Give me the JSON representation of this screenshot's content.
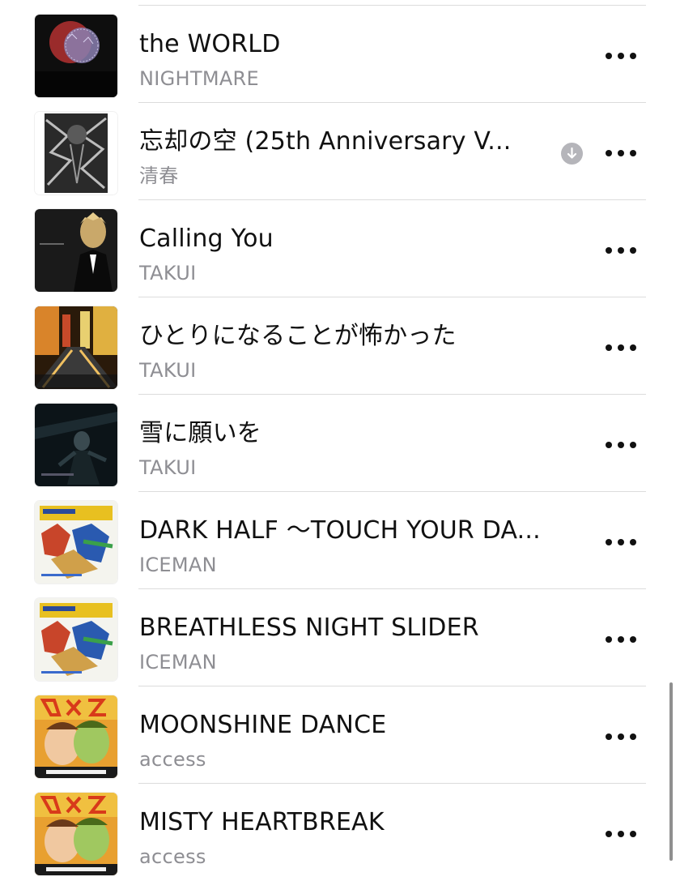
{
  "songs": [
    {
      "title": "the WORLD",
      "artist": "NIGHTMARE",
      "art": "art-the-world",
      "downloaded": false
    },
    {
      "title": "忘却の空 (25th Anniversary V...",
      "artist": "清春",
      "art": "art-boukyaku",
      "downloaded": true
    },
    {
      "title": "Calling You",
      "artist": "TAKUI",
      "art": "art-calling-you",
      "downloaded": false
    },
    {
      "title": "ひとりになることが怖かった",
      "artist": "TAKUI",
      "art": "art-hitori",
      "downloaded": false
    },
    {
      "title": "雪に願いを",
      "artist": "TAKUI",
      "art": "art-yuki",
      "downloaded": false
    },
    {
      "title": "DARK HALF 〜TOUCH YOUR DA...",
      "artist": "ICEMAN",
      "art": "art-iceman",
      "downloaded": false
    },
    {
      "title": "BREATHLESS NIGHT SLIDER",
      "artist": "ICEMAN",
      "art": "art-iceman",
      "downloaded": false
    },
    {
      "title": "MOONSHINE DANCE",
      "artist": "access",
      "art": "art-access",
      "downloaded": false
    },
    {
      "title": "MISTY HEARTBREAK",
      "artist": "access",
      "art": "art-access",
      "downloaded": false
    }
  ],
  "icons": {
    "more": "more-icon",
    "download": "download-icon"
  },
  "colors": {
    "title": "#111111",
    "subtitle": "#8e8e93",
    "divider": "#dcdcdc",
    "download_badge": "#b5b5ba"
  }
}
